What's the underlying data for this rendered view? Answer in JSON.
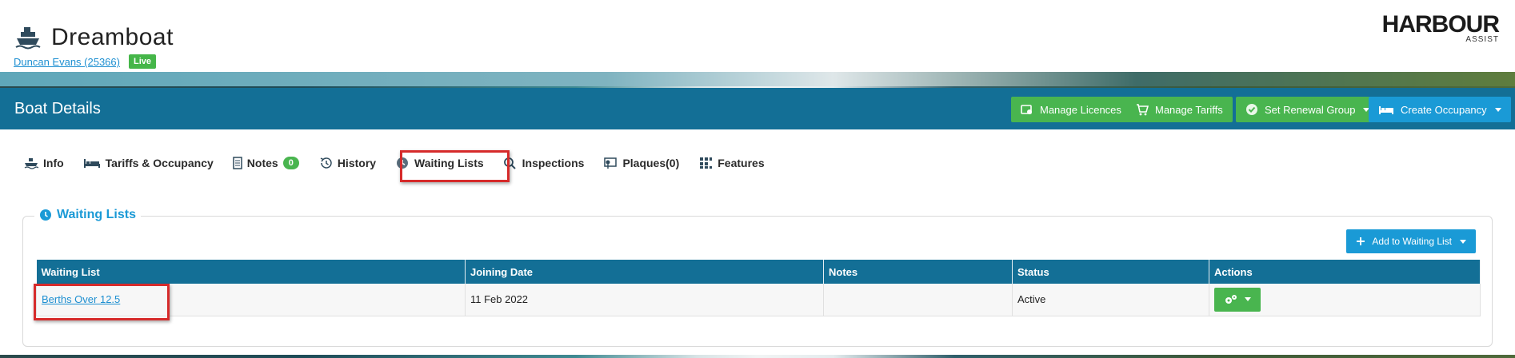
{
  "header": {
    "boat_name": "Dreamboat",
    "owner_link": "Duncan Evans (25366)",
    "status_badge": "Live",
    "brand_name": "HARBOUR",
    "brand_sub": "ASSIST"
  },
  "titlebar": {
    "title": "Boat Details",
    "buttons": [
      {
        "label": "Manage Licences",
        "icon": "licence-icon",
        "color": "#49b54f"
      },
      {
        "label": "Manage Tariffs",
        "icon": "cart-icon",
        "color": "#49b54f"
      },
      {
        "label": "Set Renewal Group",
        "icon": "check-circle-icon",
        "color": "#49b54f",
        "dropdown": true
      },
      {
        "label": "Create Occupancy",
        "icon": "bed-icon",
        "color": "#1a9ad6",
        "dropdown": true
      }
    ]
  },
  "tabs": [
    {
      "label": "Info",
      "icon": "boat-icon"
    },
    {
      "label": "Tariffs & Occupancy",
      "icon": "bed-icon"
    },
    {
      "label": "Notes",
      "icon": "notes-icon",
      "badge": "0"
    },
    {
      "label": "History",
      "icon": "history-icon"
    },
    {
      "label": "Waiting Lists",
      "icon": "clock-icon",
      "active": true
    },
    {
      "label": "Inspections",
      "icon": "search-icon"
    },
    {
      "label": "Plaques(0)",
      "icon": "plaque-icon"
    },
    {
      "label": "Features",
      "icon": "grid-icon"
    }
  ],
  "panel": {
    "title": "Waiting Lists",
    "add_button": "Add to Waiting List",
    "columns": [
      "Waiting List",
      "Joining Date",
      "Notes",
      "Status",
      "Actions"
    ],
    "rows": [
      {
        "waiting_list": "Berths Over 12.5",
        "joining_date": "11 Feb 2022",
        "notes": "",
        "status": "Active"
      }
    ]
  },
  "colors": {
    "primary": "#136f96",
    "accent_blue": "#1a9ad6",
    "green": "#49b54f",
    "highlight_red": "#d62b2b"
  }
}
